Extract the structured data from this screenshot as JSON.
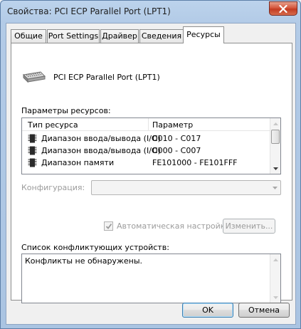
{
  "window": {
    "title": "Свойства: PCI ECP Parallel Port (LPT1)"
  },
  "tabs": [
    {
      "label": "Общие",
      "active": false
    },
    {
      "label": "Port Settings",
      "active": false
    },
    {
      "label": "Драйвер",
      "active": false
    },
    {
      "label": "Сведения",
      "active": false
    },
    {
      "label": "Ресурсы",
      "active": true
    }
  ],
  "device": {
    "name": "PCI ECP Parallel Port (LPT1)",
    "icon": "parallel-port-icon"
  },
  "resources": {
    "section_label": "Параметры ресурсов:",
    "columns": [
      "Тип ресурса",
      "Параметр"
    ],
    "rows": [
      {
        "type": "Диапазон ввода/вывода (I/O)",
        "value": "C010 - C017",
        "icon": "resource-chip-icon"
      },
      {
        "type": "Диапазон ввода/вывода (I/O)",
        "value": "C000 - C007",
        "icon": "resource-chip-icon"
      },
      {
        "type": "Диапазон памяти",
        "value": "FE101000 - FE101FFF",
        "icon": "resource-chip-icon"
      }
    ]
  },
  "config": {
    "label": "Конфигурация:",
    "value": ""
  },
  "auto": {
    "label": "Автоматическая настройка",
    "checked": true,
    "change_button": "Изменить..."
  },
  "conflicts": {
    "label": "Список конфликтующих устройств:",
    "text": "Конфликты не обнаружены."
  },
  "buttons": {
    "ok": "OK",
    "cancel": "Отмена"
  },
  "colors": {
    "title_bar": "#b3cbe7",
    "close_button": "#c23b22",
    "panel_bg": "#ffffff",
    "dialog_bg": "#f0f0f0"
  }
}
